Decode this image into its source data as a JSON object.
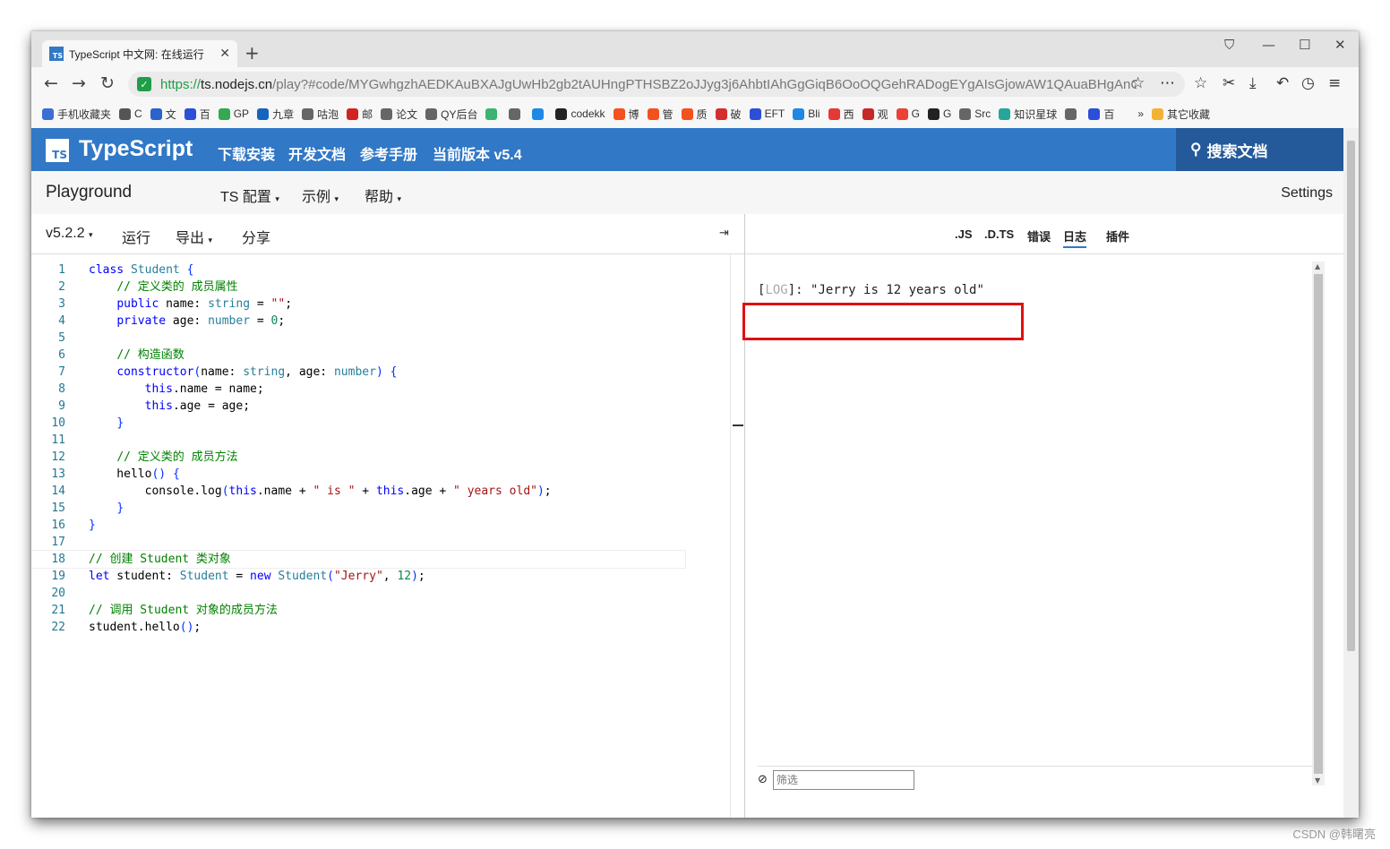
{
  "browser": {
    "tab_title": "TypeScript 中文网: 在线运行",
    "tab_favicon": "TS",
    "url_proto": "https://",
    "url_host": "ts.nodejs.cn",
    "url_path": "/play?#code/MYGwhgzhAEDKAuBXAJgUwHb2gb2tAUHngPTHSBZ2oJJyg3j6AhbtIAhGgGiqB6OoOQGehRADogEYgAIsGjowAW1QAuaBHgAnC"
  },
  "bookmarks": [
    {
      "label": "手机收藏夹",
      "color": "#3b6fd4"
    },
    {
      "label": "C",
      "color": "#555555"
    },
    {
      "label": "文",
      "color": "#2a63c9"
    },
    {
      "label": "百",
      "color": "#2c4fd8"
    },
    {
      "label": "GP",
      "color": "#34a853"
    },
    {
      "label": "九章",
      "color": "#1565c0"
    },
    {
      "label": "咕泡",
      "color": "#666666"
    },
    {
      "label": "邮",
      "color": "#d22222"
    },
    {
      "label": "论文",
      "color": "#666666"
    },
    {
      "label": "QY后台",
      "color": "#666666"
    },
    {
      "label": "",
      "color": "#3cb371"
    },
    {
      "label": "",
      "color": "#666666"
    },
    {
      "label": "",
      "color": "#1e88e5"
    },
    {
      "label": "codekk",
      "color": "#222222"
    },
    {
      "label": "博",
      "color": "#f4511e"
    },
    {
      "label": "管",
      "color": "#f4511e"
    },
    {
      "label": "质",
      "color": "#f4511e"
    },
    {
      "label": "破",
      "color": "#d32f2f"
    },
    {
      "label": "EFT",
      "color": "#2c4fd8"
    },
    {
      "label": "Bli",
      "color": "#1e88e5"
    },
    {
      "label": "西",
      "color": "#e53935"
    },
    {
      "label": "观",
      "color": "#c62828"
    },
    {
      "label": "G",
      "color": "#ea4335"
    },
    {
      "label": "G",
      "color": "#222222"
    },
    {
      "label": "Src",
      "color": "#666666"
    },
    {
      "label": "知识星球",
      "color": "#26a69a"
    },
    {
      "label": "",
      "color": "#666666"
    },
    {
      "label": "百",
      "color": "#2c4fd8"
    },
    {
      "label": "»",
      "color": "transparent"
    },
    {
      "label": "其它收藏",
      "color": "#f2b233"
    }
  ],
  "header": {
    "logo": "TS",
    "brand": "TypeScript",
    "nav": [
      "下载安装",
      "开发文档",
      "参考手册",
      "当前版本 v5.4"
    ],
    "search": "搜索文档"
  },
  "playground_bar": {
    "title": "Playground",
    "menus": [
      "TS 配置",
      "示例",
      "帮助"
    ],
    "settings": "Settings"
  },
  "editor_toolbar": {
    "version": "v5.2.2",
    "run": "运行",
    "export": "导出",
    "share": "分享"
  },
  "code_lines": [
    "class Student {",
    "    // 定义类的 成员属性",
    "    public name: string = \"\";",
    "    private age: number = 0;",
    "",
    "    // 构造函数",
    "    constructor(name: string, age: number) {",
    "        this.name = name;",
    "        this.age = age;",
    "    }",
    "",
    "    // 定义类的 成员方法",
    "    hello() {",
    "        console.log(this.name + \" is \" + this.age + \" years old\");",
    "    }",
    "}",
    "",
    "// 创建 Student 类对象",
    "let student: Student = new Student(\"Jerry\", 12);",
    "",
    "// 调用 Student 对象的成员方法",
    "student.hello();"
  ],
  "output_tabs": [
    ".JS",
    ".D.TS",
    "错误",
    "日志",
    "插件"
  ],
  "active_output_tab": "日志",
  "log": {
    "tag": "LOG",
    "message": "\"Jerry is 12 years old\""
  },
  "filter_placeholder": "筛选",
  "watermark": "CSDN @韩曙亮"
}
